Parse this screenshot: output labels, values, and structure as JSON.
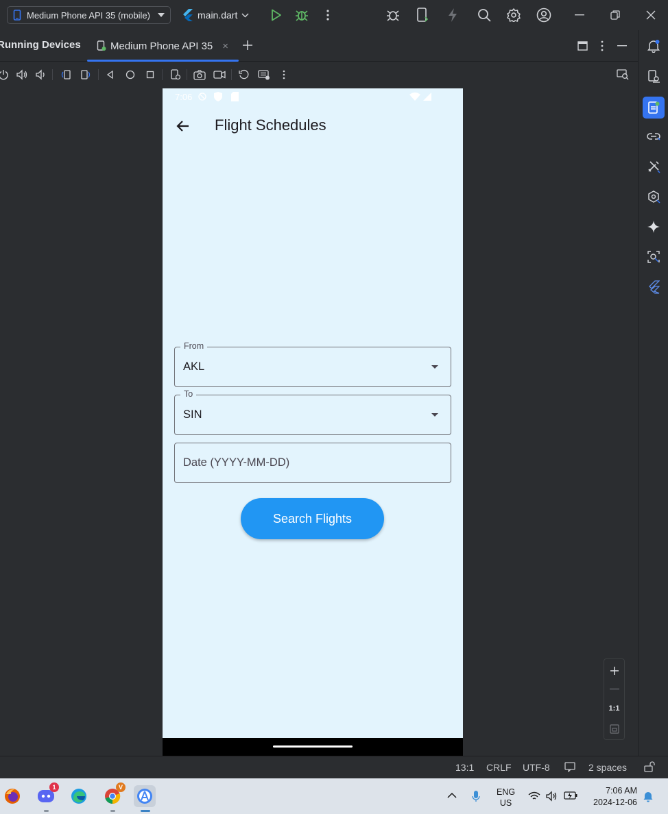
{
  "toolbar": {
    "device_select": "Medium Phone API 35 (mobile)",
    "file_select": "main.dart"
  },
  "tool_window": {
    "title": "Running Devices",
    "tab_label": "Medium Phone API 35"
  },
  "phone": {
    "status_time": "7:06",
    "app_title": "Flight Schedules",
    "from_label": "From",
    "from_value": "AKL",
    "to_label": "To",
    "to_value": "SIN",
    "date_placeholder": "Date (YYYY-MM-DD)",
    "search_button": "Search Flights"
  },
  "zoom": {
    "one_to_one": "1:1"
  },
  "ide_status": {
    "position": "13:1",
    "line_sep": "CRLF",
    "encoding": "UTF-8",
    "indent": "2 spaces"
  },
  "taskbar": {
    "discord_badge": "1",
    "chrome_badge": "V",
    "lang": "ENG",
    "region": "US",
    "time": "7:06 AM",
    "date": "2024-12-06"
  },
  "colors": {
    "ide_bg": "#2b2d30",
    "accent": "#3574f0",
    "phone_bg": "#e3f4fd",
    "button": "#2196f3",
    "run_green": "#5fb865"
  }
}
